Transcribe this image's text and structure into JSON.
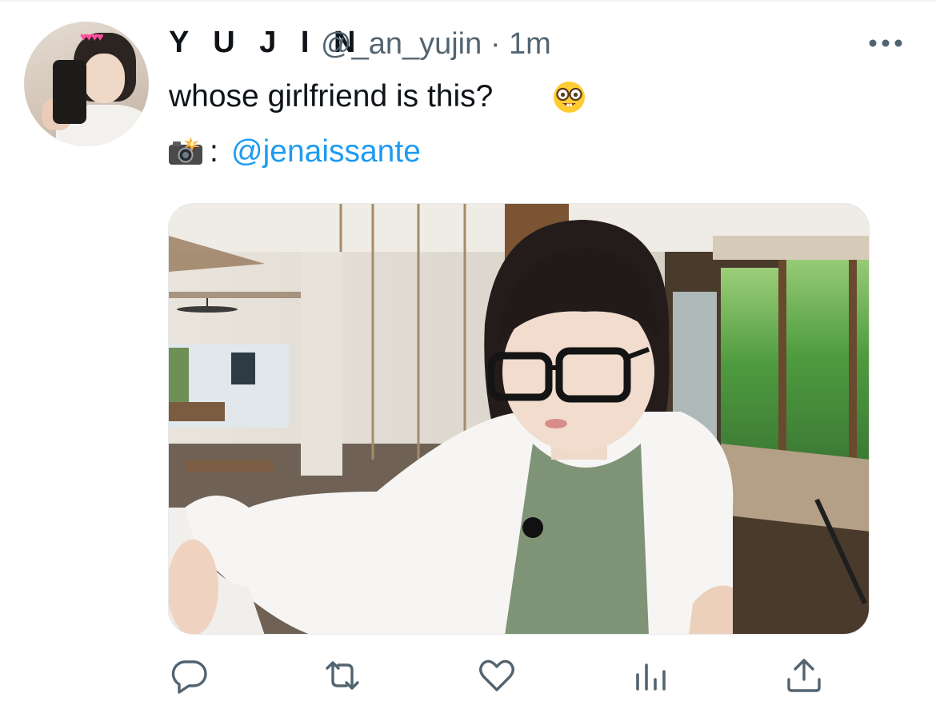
{
  "tweet": {
    "display_name": "Y U J I N",
    "handle": "@_an_yujin",
    "separator": "·",
    "time": "1m",
    "text": "whose girlfriend is this?",
    "text_emoji": "nerd-face-emoji",
    "credit_icon": "camera-flash-icon",
    "credit_colon": ":",
    "credit_mention": "@jenaissante"
  },
  "header": {
    "avatar": "avatar",
    "menu_icon": "more-icon"
  },
  "actions": [
    {
      "name": "reply",
      "icon": "reply-icon"
    },
    {
      "name": "retweet",
      "icon": "retweet-icon"
    },
    {
      "name": "like",
      "icon": "heart-icon"
    },
    {
      "name": "views",
      "icon": "views-icon"
    },
    {
      "name": "share",
      "icon": "share-icon"
    }
  ],
  "colors": {
    "text": "#0f1419",
    "secondary": "#536471",
    "link": "#1d9bf0",
    "action_icons": "#536471"
  }
}
